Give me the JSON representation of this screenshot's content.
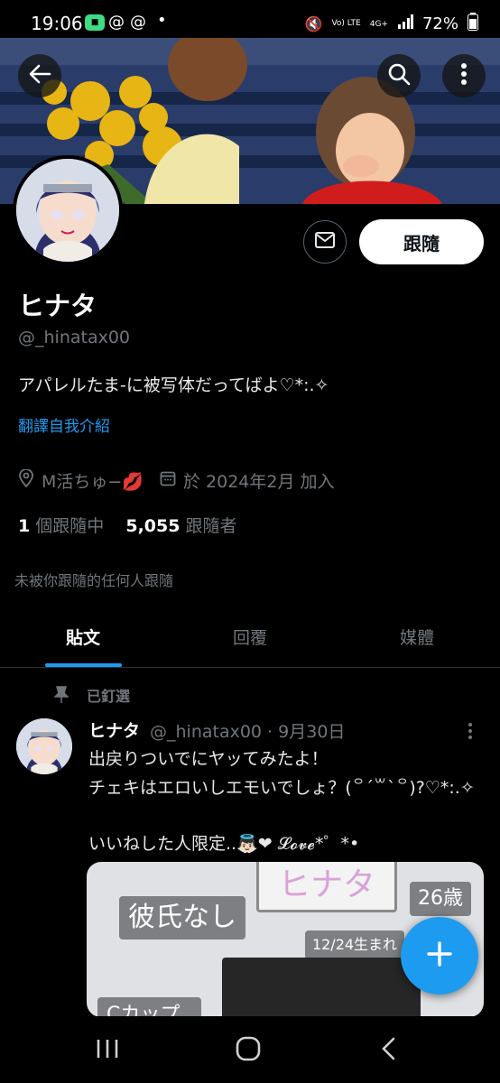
{
  "status_bar": {
    "time": "19:06",
    "battery": "72%",
    "network": "4G+",
    "volte": "Vo) LTE"
  },
  "profile": {
    "name": "ヒナタ",
    "handle": "@_hinatax00",
    "bio": "アパレルたま-に被写体だってばよ♡*:.✧",
    "translate_bio": "翻譯自我介紹",
    "location": "M活ちゅ−💋",
    "joined": "於 2024年2月 加入",
    "following_count": "1",
    "following_label": "個跟隨中",
    "followers_count": "5,055",
    "followers_label": "跟隨者",
    "not_followed_note": "未被你跟隨的任何人跟隨",
    "follow_button": "跟隨"
  },
  "tabs": [
    {
      "label": "貼文",
      "active": true
    },
    {
      "label": "回覆",
      "active": false
    },
    {
      "label": "媒體",
      "active": false
    }
  ],
  "pinned_tweet": {
    "pinned_label": "已釘選",
    "name": "ヒナタ",
    "handle_date": "@_hinatax00 · 9月30日",
    "line1": "出戻りついでにヤッてみたよ！",
    "line2": "チェキはエロいしエモいでしょ？(꒪ˊ꒳ˋ꒪)?♡*:.✧",
    "line3": "いいねした人限定..👼🏻❤ 𝓛𝓸𝓿𝓮*゜*•",
    "media_labels": {
      "name": "ヒナタ",
      "age": "26歳",
      "status": "彼氏なし",
      "birthday": "12/24生まれ",
      "partial": "Cカップ"
    }
  },
  "icons": [
    "back-arrow-icon",
    "search-icon",
    "more-vertical-icon",
    "mail-icon",
    "location-pin-icon",
    "calendar-icon",
    "pin-icon",
    "plus-icon",
    "recent-apps-icon",
    "home-icon",
    "back-nav-icon"
  ],
  "colors": {
    "accent": "#1d9bf0",
    "background": "#000000",
    "muted": "#71767b"
  }
}
